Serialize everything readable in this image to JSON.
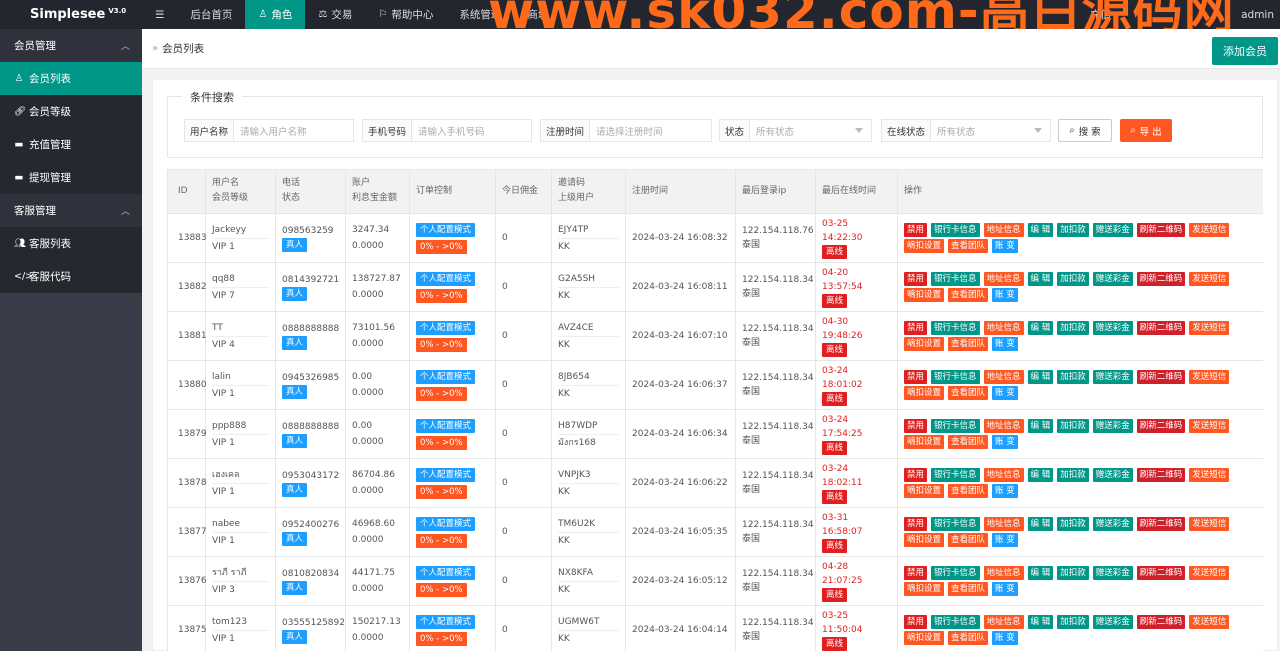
{
  "topbar": {
    "brand": "Simplesee",
    "version": "V3.0",
    "menu_icon": "hamburger-icon",
    "nav": [
      {
        "label": "后台首页",
        "icon": ""
      },
      {
        "label": "角色",
        "icon": "user-icon",
        "active": true
      },
      {
        "label": "交易",
        "icon": "scale-icon"
      },
      {
        "label": "帮助中心",
        "icon": "flag-icon"
      },
      {
        "label": "系统管理",
        "icon": ""
      },
      {
        "label": "商城",
        "icon": ""
      }
    ],
    "right_text": "充值",
    "user": "admin",
    "watermark": "www.sk032.com-高白源码网"
  },
  "sidebar": {
    "groups": [
      {
        "label": "会员管理",
        "items": [
          {
            "label": "会员列表",
            "icon": "user-icon",
            "active": true
          },
          {
            "label": "会员等级",
            "icon": "link-icon"
          },
          {
            "label": "充值管理",
            "icon": "card-icon"
          },
          {
            "label": "提现管理",
            "icon": "card-icon"
          }
        ]
      },
      {
        "label": "客服管理",
        "items": [
          {
            "label": "客服列表",
            "icon": "users-icon"
          },
          {
            "label": "客服代码",
            "icon": "code-icon"
          }
        ]
      }
    ]
  },
  "breadcrumb": {
    "sep": "»",
    "current": "会员列表"
  },
  "add_button": "添加会员",
  "filter": {
    "legend": "条件搜索",
    "fields": [
      {
        "label": "用户名称",
        "placeholder": "请输入用户名称"
      },
      {
        "label": "手机号码",
        "placeholder": "请输入手机号码"
      },
      {
        "label": "注册时间",
        "placeholder": "请选择注册时间"
      },
      {
        "label": "状态",
        "placeholder": "所有状态"
      },
      {
        "label": "在线状态",
        "placeholder": "所有状态"
      }
    ],
    "search_label": "搜 索",
    "export_label": "导 出"
  },
  "table": {
    "headers": {
      "id": "ID",
      "user_a": "用户名",
      "user_b": "会员等级",
      "phone_a": "电话",
      "phone_b": "状态",
      "acct_a": "账户",
      "acct_b": "利息宝金额",
      "order": "订单控制",
      "commission": "今日佣金",
      "invite_a": "邀请码",
      "invite_b": "上级用户",
      "reg": "注册时间",
      "ip": "最后登录ip",
      "online": "最后在线时间",
      "ops": "操作"
    },
    "order_badge": "个人配置模式",
    "order_range": "0% - >0%",
    "status_badge": "真人",
    "offline_badge": "离线",
    "ops_line1": [
      "禁用",
      "银行卡信息",
      "地址信息",
      "编 辑",
      "加扣款",
      "赠送彩金",
      "刷新二维码",
      "发送短信"
    ],
    "ops_line2": [
      "嘀扣设置",
      "查看团队",
      "账 变"
    ],
    "rows": [
      {
        "id": "13883",
        "user": "Jackeyy",
        "vip": "VIP 1",
        "phone": "098563259",
        "balance": "3247.34",
        "interest": "0.0000",
        "commission": "0",
        "invite": "EJY4TP",
        "parent": "KK",
        "reg": "2024-03-24 16:08:32",
        "ip": "122.154.118.76",
        "country": "泰国",
        "last": "03-25 14:22:30"
      },
      {
        "id": "13882",
        "user": "qq88",
        "vip": "VIP 7",
        "phone": "0814392721",
        "balance": "138727.87",
        "interest": "0.0000",
        "commission": "0",
        "invite": "G2A5SH",
        "parent": "KK",
        "reg": "2024-03-24 16:08:11",
        "ip": "122.154.118.34",
        "country": "泰国",
        "last": "04-20 13:57:54"
      },
      {
        "id": "13881",
        "user": "TT",
        "vip": "VIP 4",
        "phone": "0888888888",
        "balance": "73101.56",
        "interest": "0.0000",
        "commission": "0",
        "invite": "AVZ4CE",
        "parent": "KK",
        "reg": "2024-03-24 16:07:10",
        "ip": "122.154.118.34",
        "country": "泰国",
        "last": "04-30 19:48:26"
      },
      {
        "id": "13880",
        "user": "lalin",
        "vip": "VIP 1",
        "phone": "0945326985",
        "balance": "0.00",
        "interest": "0.0000",
        "commission": "0",
        "invite": "8JB654",
        "parent": "KK",
        "reg": "2024-03-24 16:06:37",
        "ip": "122.154.118.34",
        "country": "泰国",
        "last": "03-24 18:01:02"
      },
      {
        "id": "13879",
        "user": "ppp888",
        "vip": "VIP 1",
        "phone": "0888888888",
        "balance": "0.00",
        "interest": "0.0000",
        "commission": "0",
        "invite": "H87WDP",
        "parent": "มังกร168",
        "reg": "2024-03-24 16:06:34",
        "ip": "122.154.118.34",
        "country": "泰国",
        "last": "03-24 17:54:25"
      },
      {
        "id": "13878",
        "user": "เฮงเคล",
        "vip": "VIP 1",
        "phone": "0953043172",
        "balance": "86704.86",
        "interest": "0.0000",
        "commission": "0",
        "invite": "VNPJK3",
        "parent": "KK",
        "reg": "2024-03-24 16:06:22",
        "ip": "122.154.118.34",
        "country": "泰国",
        "last": "03-24 18:02:11"
      },
      {
        "id": "13877",
        "user": "nabee",
        "vip": "VIP 1",
        "phone": "0952400276",
        "balance": "46968.60",
        "interest": "0.0000",
        "commission": "0",
        "invite": "TM6U2K",
        "parent": "KK",
        "reg": "2024-03-24 16:05:35",
        "ip": "122.154.118.34",
        "country": "泰国",
        "last": "03-31 16:58:07"
      },
      {
        "id": "13876",
        "user": "ราภี ราภี",
        "vip": "VIP 3",
        "phone": "0810820834",
        "balance": "44171.75",
        "interest": "0.0000",
        "commission": "0",
        "invite": "NX8KFA",
        "parent": "KK",
        "reg": "2024-03-24 16:05:12",
        "ip": "122.154.118.34",
        "country": "泰国",
        "last": "04-28 21:07:25"
      },
      {
        "id": "13875",
        "user": "tom123",
        "vip": "VIP 1",
        "phone": "03555125892",
        "balance": "150217.13",
        "interest": "0.0000",
        "commission": "0",
        "invite": "UGMW6T",
        "parent": "KK",
        "reg": "2024-03-24 16:04:14",
        "ip": "122.154.118.34",
        "country": "泰国",
        "last": "03-25 11:50:04"
      }
    ]
  },
  "colors": {
    "topbar": "#23262e",
    "sidebar": "#393d49",
    "accent": "#009688",
    "danger": "#e02020",
    "warn": "#ff5722",
    "info": "#1e9fff"
  }
}
